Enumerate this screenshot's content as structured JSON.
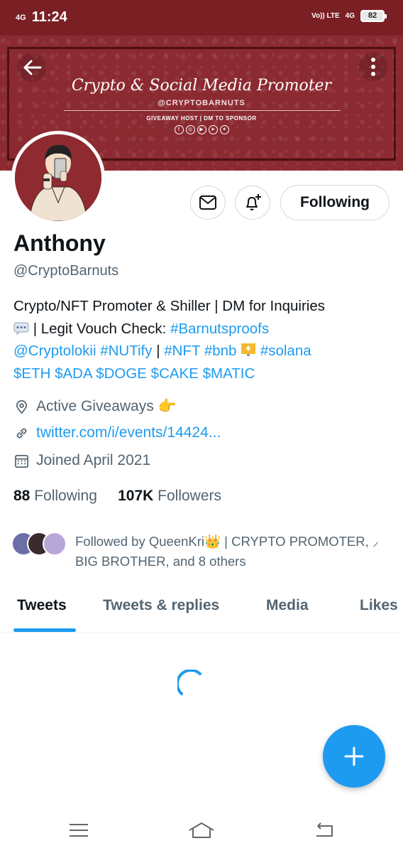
{
  "status_bar": {
    "network_left": "4G",
    "time": "11:24",
    "volte": "Vo)) LTE",
    "network_right": "4G",
    "battery": "82"
  },
  "banner": {
    "title": "Crypto & Social Media Promoter",
    "handle": "@CRYPTOBARNUTS",
    "subtitle": "GIVEAWAY HOST | DM TO SPONSOR",
    "color": "#8b2a31"
  },
  "profile": {
    "name": "Anthony",
    "handle": "@CryptoBarnuts",
    "follow_label": "Following",
    "bio": {
      "line1": "Crypto/NFT Promoter & Shiller | DM for Inquiries",
      "line2_text": " | Legit Vouch Check: ",
      "tag_barnutsproofs": "#Barnutsproofs",
      "mention_cryptolokii": "@Cryptolokii",
      "tag_nutify": "#NUTify",
      "sep": "  | ",
      "tag_nft": "#NFT",
      "tag_bnb": "#bnb",
      "tag_solana": "#solana",
      "cashtags": "$ETH $ADA $DOGE $CAKE $MATIC"
    },
    "location": "Active Giveaways 👉",
    "website": "twitter.com/i/events/14424...",
    "joined": "Joined April 2021",
    "following_count": "88",
    "following_label": "Following",
    "followers_count": "107K",
    "followers_label": "Followers",
    "followed_by": "Followed by QueenKri👑 | CRYPTO PROMOTER, ⸝ BIG BROTHER, and 8 others"
  },
  "tabs": [
    "Tweets",
    "Tweets & replies",
    "Media",
    "Likes"
  ],
  "colors": {
    "accent": "#1d9bf0",
    "status_bar": "#7a1f24",
    "secondary_text": "#536471"
  }
}
